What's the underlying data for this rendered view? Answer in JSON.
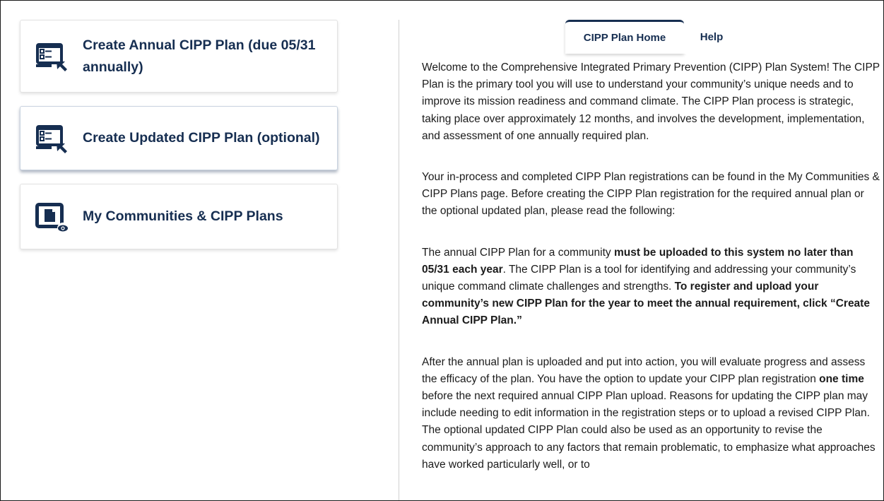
{
  "cards": [
    {
      "label": "Create Annual CIPP Plan (due 05/31 annually)",
      "icon": "plan-create-icon"
    },
    {
      "label": "Create Updated CIPP Plan (optional)",
      "icon": "plan-create-icon"
    },
    {
      "label": "My Communities & CIPP Plans",
      "icon": "document-view-icon"
    }
  ],
  "tabs": [
    {
      "label": "CIPP Plan Home",
      "active": true
    },
    {
      "label": "Help",
      "active": false
    }
  ],
  "colors": {
    "brand_navy": "#162e51",
    "text": "#1b1b1b"
  },
  "content": {
    "p1": "Welcome to the Comprehensive Integrated Primary Prevention (CIPP) Plan System! The CIPP Plan is the primary tool you will use to understand your community’s unique needs and to improve its mission readiness and command climate. The CIPP Plan process is strategic, taking place over approximately 12 months, and involves the development, implementation, and assessment of one annually required plan.",
    "p2": "Your in-process and completed CIPP Plan registrations can be found in the My Communities & CIPP Plans page. Before creating the CIPP Plan registration for the required annual plan or the optional updated plan, please read the following:",
    "p3_a": "The annual CIPP Plan for a community ",
    "p3_b": "must be uploaded to this system no later than 05/31 each year",
    "p3_c": ". The CIPP Plan is a tool for identifying and addressing your community’s unique command climate challenges and strengths. ",
    "p3_d": "To register and upload your community’s new CIPP Plan for the year to meet the annual requirement, click “Create Annual CIPP Plan.”",
    "p4_a": "After the annual plan is uploaded and put into action, you will evaluate progress and assess the efficacy of the plan. You have the option to update your CIPP plan registration ",
    "p4_b": "one time",
    "p4_c": " before the next required annual CIPP Plan upload. Reasons for updating the CIPP plan may include needing to edit information in the registration steps or to upload a revised CIPP Plan. The optional updated CIPP Plan could also be used as an opportunity to revise the community’s approach to any factors that remain problematic, to emphasize what approaches have worked particularly well, or to"
  }
}
